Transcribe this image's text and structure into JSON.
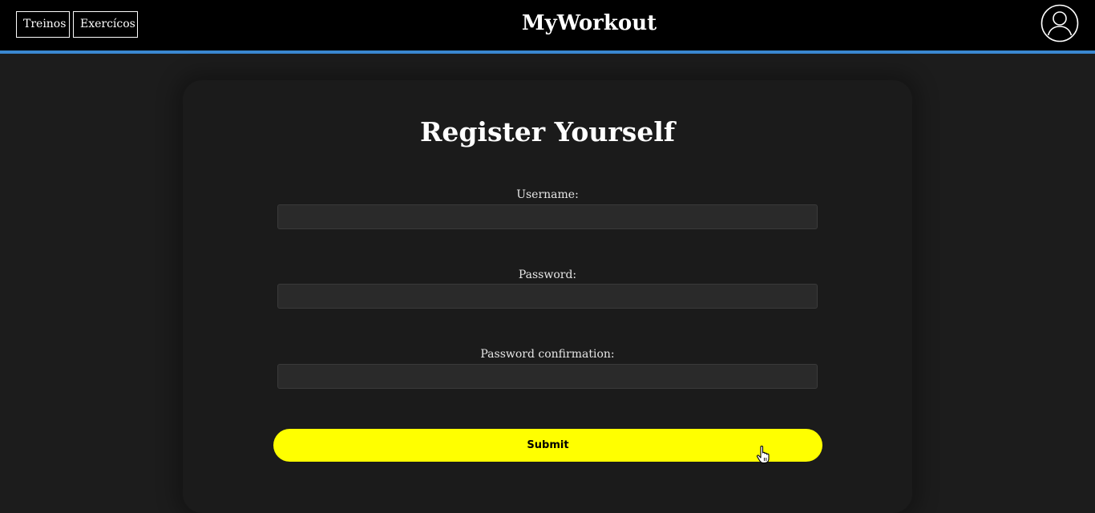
{
  "nav": {
    "brand": "MyWorkout",
    "items": [
      {
        "label": "Treinos"
      },
      {
        "label": "Exercícos"
      }
    ],
    "profile_icon": "user-circle-icon"
  },
  "colors": {
    "accent_line": "#3a87d0",
    "submit_bg": "#ffff00",
    "page_bg": "#1c1c1c"
  },
  "form": {
    "title": "Register Yourself",
    "fields": [
      {
        "label": "Username:",
        "value": "",
        "placeholder": ""
      },
      {
        "label": "Password:",
        "value": "",
        "placeholder": ""
      },
      {
        "label": "Password confirmation:",
        "value": "",
        "placeholder": ""
      }
    ],
    "submit_label": "Submit"
  }
}
